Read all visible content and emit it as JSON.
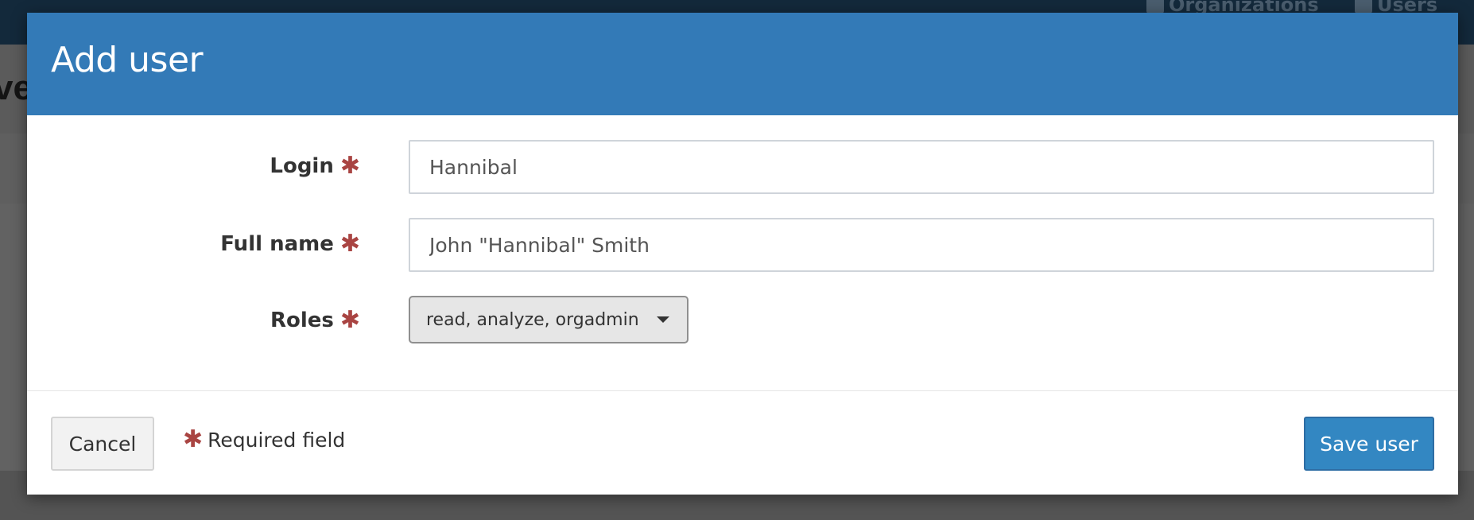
{
  "background": {
    "nav_items": [
      {
        "label": "Organizations",
        "icon": "list-icon"
      },
      {
        "label": "Users",
        "icon": "users-icon"
      }
    ],
    "page_title_fragment": "ve"
  },
  "modal": {
    "title": "Add user",
    "fields": {
      "login": {
        "label": "Login",
        "value": "Hannibal",
        "required": true
      },
      "full_name": {
        "label": "Full name",
        "value": "John \"Hannibal\" Smith",
        "required": true
      },
      "roles": {
        "label": "Roles",
        "value": "read, analyze, orgadmin",
        "required": true
      }
    },
    "required_star": "✱",
    "footer": {
      "cancel_label": "Cancel",
      "required_note": "Required field",
      "save_label": "Save user"
    }
  },
  "colors": {
    "header": "#337ab7",
    "required": "#a94442",
    "primary_button": "#3387c2"
  }
}
